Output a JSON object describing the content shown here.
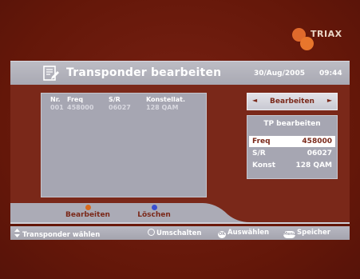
{
  "brand": {
    "logo_text": "TRIAX"
  },
  "header": {
    "title": "Transponder bearbeiten",
    "date": "30/Aug/2005",
    "time": "09:44"
  },
  "list": {
    "columns": [
      "Nr.",
      "Freq",
      "S/R",
      "Konstellat."
    ],
    "rows": [
      {
        "nr": "001",
        "freq": "458000",
        "sr": "06027",
        "konst": "128 QAM"
      }
    ]
  },
  "selector": {
    "label": "Bearbeiten",
    "left_arrow": "◄",
    "right_arrow": "►"
  },
  "tp_edit": {
    "title": "TP bearbeiten",
    "fields": [
      {
        "key": "Freq",
        "value": "458000",
        "active": true
      },
      {
        "key": "S/R",
        "value": "06027",
        "active": false
      },
      {
        "key": "Konst",
        "value": "128 QAM",
        "active": false
      }
    ]
  },
  "color_buttons": [
    {
      "label": "Bearbeiten",
      "color": "#d86a1e"
    },
    {
      "label": "Löschen",
      "color": "#3a4fd0"
    }
  ],
  "help": {
    "item1": "Transponder wählen",
    "item2": "Umschalten",
    "item3": "Auswählen",
    "item4": "Speicher",
    "ok_text": "OK",
    "menu_text": "Menu"
  },
  "colors": {
    "background": "#6e1b10",
    "panel": "#7a2819",
    "grey": "#a6a6b2",
    "accent_text": "#7a2819"
  }
}
